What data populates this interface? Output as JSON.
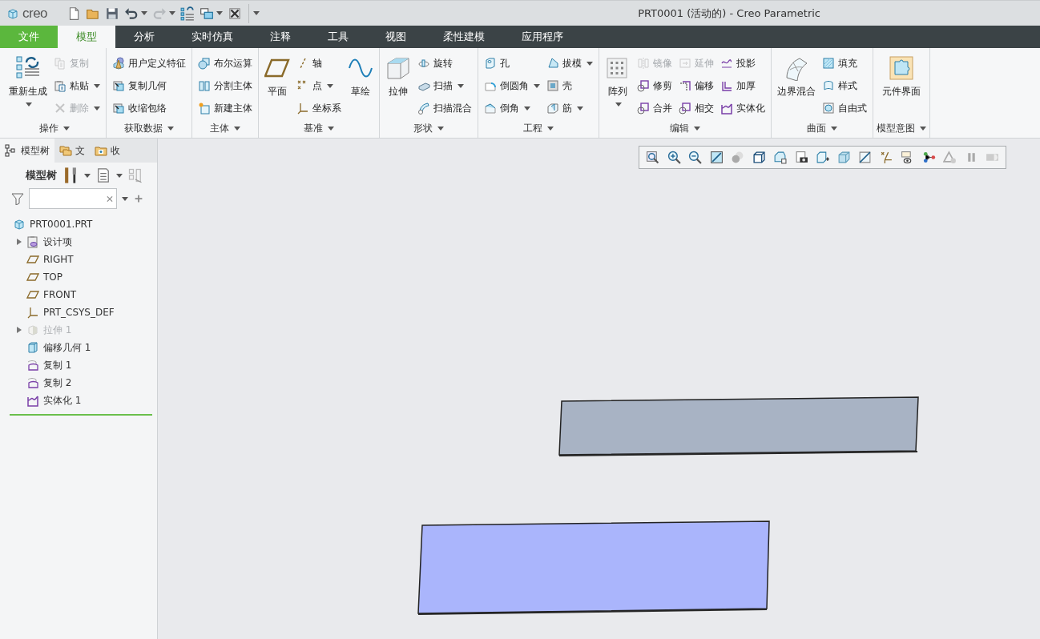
{
  "title_bar": {
    "logo": "creo",
    "title": "PRT0001 (活动的) - Creo Parametric"
  },
  "tabs": [
    {
      "label": "文件",
      "kind": "file",
      "selected": false
    },
    {
      "label": "模型",
      "kind": "tab",
      "selected": true
    },
    {
      "label": "分析",
      "kind": "tab",
      "selected": false
    },
    {
      "label": "实时仿真",
      "kind": "tab",
      "selected": false
    },
    {
      "label": "注释",
      "kind": "tab",
      "selected": false
    },
    {
      "label": "工具",
      "kind": "tab",
      "selected": false
    },
    {
      "label": "视图",
      "kind": "tab",
      "selected": false
    },
    {
      "label": "柔性建模",
      "kind": "tab",
      "selected": false
    },
    {
      "label": "应用程序",
      "kind": "tab",
      "selected": false
    }
  ],
  "ribbon": {
    "groups": [
      {
        "label": "操作",
        "items": [
          {
            "label": "重新生成",
            "kind": "large",
            "menu": true,
            "disabled": false
          },
          {
            "label": "复制",
            "kind": "small",
            "menu": false,
            "disabled": true
          },
          {
            "label": "粘贴",
            "kind": "small",
            "menu": true,
            "disabled": false
          },
          {
            "label": "删除",
            "kind": "small",
            "menu": true,
            "disabled": true
          }
        ]
      },
      {
        "label": "获取数据",
        "items": [
          {
            "label": "用户定义特征",
            "kind": "small",
            "menu": false,
            "disabled": false
          },
          {
            "label": "复制几何",
            "kind": "small",
            "menu": false,
            "disabled": false
          },
          {
            "label": "收缩包络",
            "kind": "small",
            "menu": false,
            "disabled": false
          }
        ]
      },
      {
        "label": "主体",
        "items": [
          {
            "label": "布尔运算",
            "kind": "small",
            "menu": false,
            "disabled": false
          },
          {
            "label": "分割主体",
            "kind": "small",
            "menu": false,
            "disabled": false
          },
          {
            "label": "新建主体",
            "kind": "small",
            "menu": false,
            "disabled": false
          }
        ]
      },
      {
        "label": "基准",
        "items": [
          {
            "label": "平面",
            "kind": "large",
            "menu": false,
            "disabled": false
          },
          {
            "label": "轴",
            "kind": "small",
            "menu": false,
            "disabled": false
          },
          {
            "label": "点",
            "kind": "small",
            "menu": true,
            "disabled": false
          },
          {
            "label": "坐标系",
            "kind": "small",
            "menu": false,
            "disabled": false
          },
          {
            "label": "草绘",
            "kind": "large",
            "menu": false,
            "disabled": false
          }
        ]
      },
      {
        "label": "形状",
        "items": [
          {
            "label": "拉伸",
            "kind": "large",
            "menu": false,
            "disabled": false
          },
          {
            "label": "旋转",
            "kind": "small",
            "menu": false,
            "disabled": false
          },
          {
            "label": "扫描",
            "kind": "small",
            "menu": true,
            "disabled": false
          },
          {
            "label": "扫描混合",
            "kind": "small",
            "menu": false,
            "disabled": false
          }
        ]
      },
      {
        "label": "工程",
        "items": [
          {
            "label": "孔",
            "kind": "small",
            "menu": false,
            "disabled": false
          },
          {
            "label": "倒圆角",
            "kind": "small",
            "menu": true,
            "disabled": false
          },
          {
            "label": "倒角",
            "kind": "small",
            "menu": true,
            "disabled": false
          },
          {
            "label": "拔模",
            "kind": "small",
            "menu": true,
            "disabled": false
          },
          {
            "label": "壳",
            "kind": "small",
            "menu": false,
            "disabled": false
          },
          {
            "label": "筋",
            "kind": "small",
            "menu": true,
            "disabled": false
          }
        ]
      },
      {
        "label": "编辑",
        "items": [
          {
            "label": "阵列",
            "kind": "large",
            "menu": true,
            "disabled": false
          },
          {
            "label": "镜像",
            "kind": "small",
            "menu": false,
            "disabled": true
          },
          {
            "label": "修剪",
            "kind": "small",
            "menu": false,
            "disabled": false
          },
          {
            "label": "合并",
            "kind": "small",
            "menu": false,
            "disabled": false
          },
          {
            "label": "延伸",
            "kind": "small",
            "menu": false,
            "disabled": true
          },
          {
            "label": "偏移",
            "kind": "small",
            "menu": false,
            "disabled": false
          },
          {
            "label": "相交",
            "kind": "small",
            "menu": false,
            "disabled": false
          },
          {
            "label": "投影",
            "kind": "small",
            "menu": false,
            "disabled": false
          },
          {
            "label": "加厚",
            "kind": "small",
            "menu": false,
            "disabled": false
          },
          {
            "label": "实体化",
            "kind": "small",
            "menu": false,
            "disabled": false
          }
        ]
      },
      {
        "label": "曲面",
        "items": [
          {
            "label": "边界混合",
            "kind": "large",
            "menu": false,
            "disabled": false
          },
          {
            "label": "填充",
            "kind": "small",
            "menu": false,
            "disabled": false
          },
          {
            "label": "样式",
            "kind": "small",
            "menu": false,
            "disabled": false
          },
          {
            "label": "自由式",
            "kind": "small",
            "menu": false,
            "disabled": false
          }
        ]
      },
      {
        "label": "模型意图",
        "items": [
          {
            "label": "元件界面",
            "kind": "large",
            "menu": false,
            "disabled": false
          }
        ]
      }
    ]
  },
  "model_tree": {
    "tabs": [
      {
        "label": "模型树",
        "selected": true
      },
      {
        "label": "文",
        "selected": false
      },
      {
        "label": "收",
        "selected": false
      }
    ],
    "toolbar_label": "模型树",
    "items": [
      {
        "label": "PRT0001.PRT",
        "collapsed": false,
        "dimmed": false,
        "children": [
          {
            "label": "设计项",
            "collapsed": true,
            "dimmed": false
          },
          {
            "label": "RIGHT",
            "collapsed": false,
            "dimmed": false
          },
          {
            "label": "TOP",
            "collapsed": false,
            "dimmed": false
          },
          {
            "label": "FRONT",
            "collapsed": false,
            "dimmed": false
          },
          {
            "label": "PRT_CSYS_DEF",
            "collapsed": false,
            "dimmed": false
          },
          {
            "label": "拉伸 1",
            "collapsed": true,
            "dimmed": true
          },
          {
            "label": "偏移几何 1",
            "collapsed": false,
            "dimmed": false
          },
          {
            "label": "复制 1",
            "collapsed": false,
            "dimmed": false
          },
          {
            "label": "复制 2",
            "collapsed": false,
            "dimmed": false
          },
          {
            "label": "实体化 1",
            "collapsed": false,
            "dimmed": false
          }
        ]
      }
    ]
  }
}
